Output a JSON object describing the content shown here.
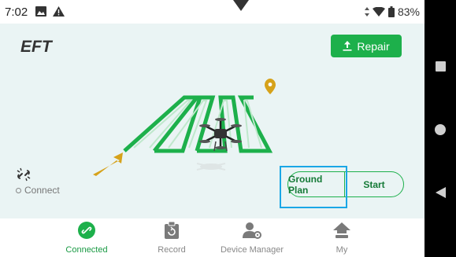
{
  "status_bar": {
    "time": "7:02",
    "battery": "83%"
  },
  "header": {
    "logo": "EFT",
    "repair_label": "Repair"
  },
  "connection": {
    "label": "Connect"
  },
  "actions": {
    "ground_plan_label": "Ground Plan",
    "start_label": "Start"
  },
  "tabs": [
    {
      "label": "Connected",
      "icon": "link-icon",
      "active": true
    },
    {
      "label": "Record",
      "icon": "clipboard-icon",
      "active": false
    },
    {
      "label": "Device Manager",
      "icon": "device-manager-icon",
      "active": false
    },
    {
      "label": "My",
      "icon": "home-icon",
      "active": false
    }
  ],
  "colors": {
    "accent": "#1db04b",
    "background": "#eaf4f4",
    "highlight": "#1aa7e6",
    "path_marker": "#d6a21a"
  }
}
